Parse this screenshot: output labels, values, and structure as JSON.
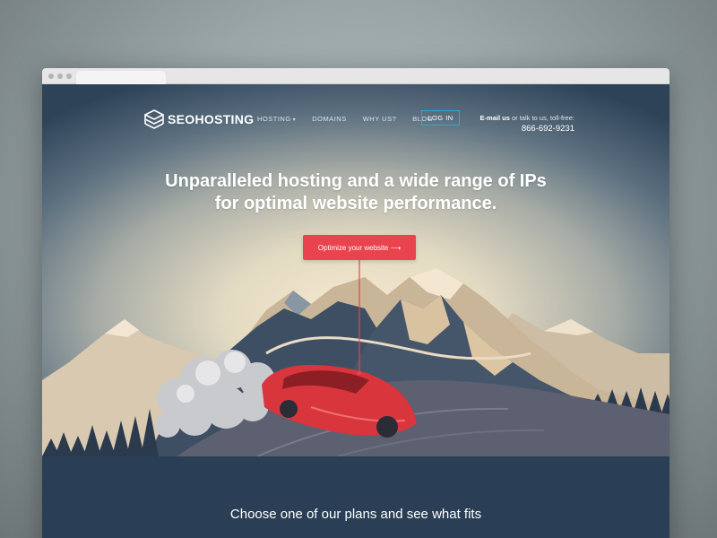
{
  "brand": {
    "name": "SEOHOSTING",
    "logo_icon": "cube-stack-icon"
  },
  "nav": {
    "items": [
      {
        "label": "HOSTING",
        "has_dropdown": true
      },
      {
        "label": "DOMAINS",
        "has_dropdown": false
      },
      {
        "label": "WHY US?",
        "has_dropdown": false
      },
      {
        "label": "BLOG",
        "has_dropdown": false
      }
    ],
    "login_label": "LOG IN"
  },
  "contact": {
    "email_label": "E-mail us",
    "middle_text": " or talk to us, toll-free:",
    "phone": "866-692-9231"
  },
  "hero": {
    "headline_line1": "Unparalleled hosting and a wide range of IPs",
    "headline_line2": "for optimal website performance.",
    "cta_label": "Optimize your website ⟶"
  },
  "plans_section": {
    "title": "Choose one of our plans and see what fits"
  },
  "colors": {
    "navy": "#2a3f55",
    "accent_red": "#e9434d",
    "login_border": "#2ba7d8",
    "road": "#5c6070",
    "mountain_dark": "#3e4f63",
    "mountain_light": "#e0c8a5"
  }
}
